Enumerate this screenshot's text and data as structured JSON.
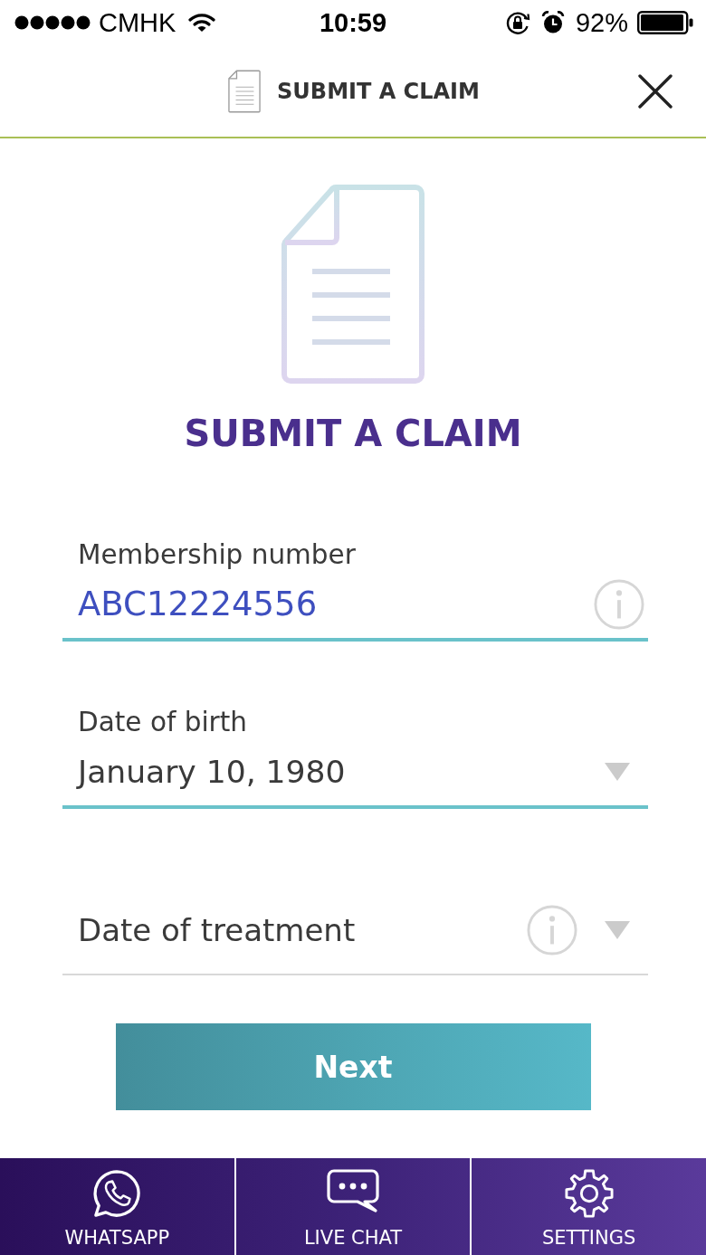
{
  "status_bar": {
    "carrier": "CMHK",
    "time": "10:59",
    "battery": "92%"
  },
  "header": {
    "title": "SUBMIT A CLAIM"
  },
  "hero": {
    "title": "SUBMIT A CLAIM"
  },
  "fields": [
    {
      "kind": "text",
      "label": "Membership number",
      "value": "ABC12224556",
      "info": true
    },
    {
      "kind": "dropdown",
      "label": "Date of birth",
      "value": "January 10, 1980",
      "info": false
    },
    {
      "kind": "dropdown",
      "placeholder": "Date of treatment",
      "info": true
    }
  ],
  "next_button": {
    "label": "Next"
  },
  "bottom_nav": [
    {
      "kind": "whatsapp",
      "label": "WHATSAPP"
    },
    {
      "kind": "chat",
      "label": "LIVE CHAT"
    },
    {
      "kind": "settings",
      "label": "SETTINGS"
    }
  ]
}
